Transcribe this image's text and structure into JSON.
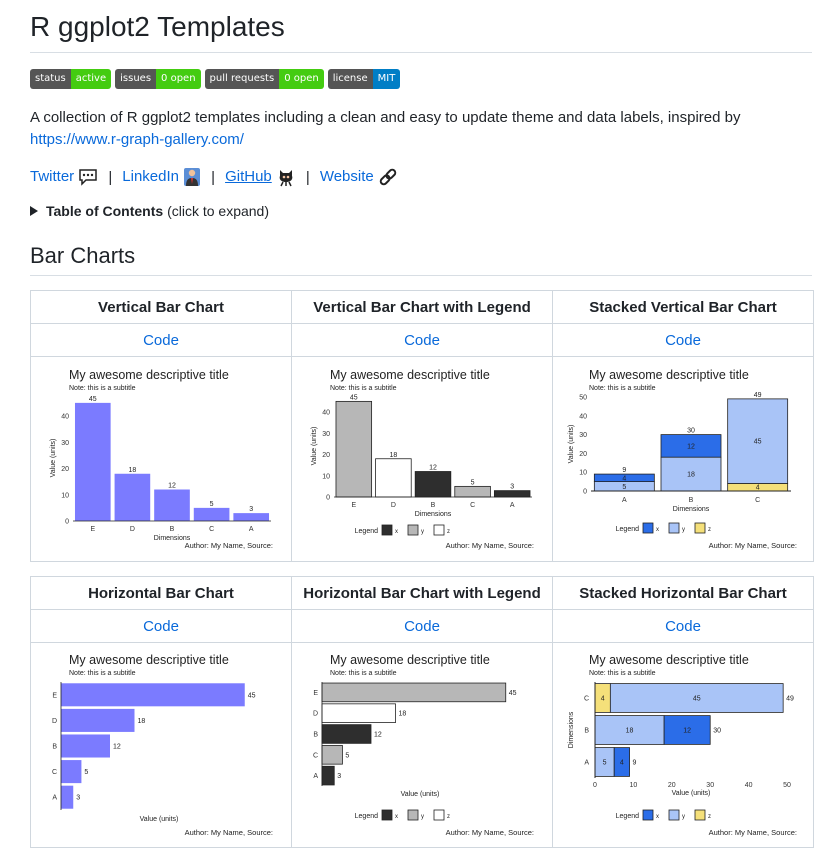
{
  "title": "R ggplot2 Templates",
  "badges": [
    {
      "label": "status",
      "value": "active",
      "color": "#4c1"
    },
    {
      "label": "issues",
      "value": "0 open",
      "color": "#4c1"
    },
    {
      "label": "pull requests",
      "value": "0 open",
      "color": "#4c1"
    },
    {
      "label": "license",
      "value": "MIT",
      "color": "#007ec6"
    }
  ],
  "description": "A collection of R ggplot2 templates including a clean and easy to update theme and data labels, inspired by",
  "description_link": "https://www.r-graph-gallery.com/",
  "social": {
    "twitter": "Twitter",
    "linkedin": "LinkedIn",
    "github": "GitHub",
    "website": "Website",
    "sep": "|"
  },
  "toc": {
    "label": "Table of Contents",
    "hint": "(click to expand)"
  },
  "section_title": "Bar Charts",
  "code_label": "Code",
  "headers_row1": [
    "Vertical Bar Chart",
    "Vertical Bar Chart with Legend",
    "Stacked Vertical Bar Chart"
  ],
  "headers_row2": [
    "Horizontal Bar Chart",
    "Horizontal Bar Chart with Legend",
    "Stacked Horizontal Bar Chart"
  ],
  "chart_common": {
    "title": "My awesome descriptive title",
    "subtitle": "Note: this is a subtitle",
    "caption": "Author: My Name, Source:",
    "legend_title": "Legend"
  },
  "colors": {
    "blue": "#7b7bff",
    "x": "#2e2e2e",
    "y": "#b7b7b7",
    "z": "#ffffff",
    "sx": "#2b6de8",
    "sy": "#a9c4f7",
    "sz": "#f5e07a"
  },
  "chart_data": [
    {
      "type": "bar",
      "name": "vbar",
      "categories": [
        "E",
        "D",
        "B",
        "C",
        "A"
      ],
      "values": [
        45,
        18,
        12,
        5,
        3
      ],
      "title": "My awesome descriptive title",
      "subtitle": "Note: this is a subtitle",
      "xlabel": "Dimensions",
      "ylabel": "Value (units)",
      "yticks": [
        0,
        10,
        20,
        30,
        40
      ],
      "ylim": [
        0,
        48
      ]
    },
    {
      "type": "bar",
      "name": "vbar-legend",
      "categories": [
        "E",
        "D",
        "B",
        "C",
        "A"
      ],
      "values": [
        45,
        18,
        12,
        5,
        3
      ],
      "groups": [
        "Y",
        "Z",
        "X",
        "Y",
        "X"
      ],
      "legend": [
        "X",
        "Y",
        "Z"
      ],
      "title": "My awesome descriptive title",
      "subtitle": "Note: this is a subtitle",
      "xlabel": "Dimensions",
      "ylabel": "Value (units)",
      "yticks": [
        0,
        10,
        20,
        30,
        40
      ],
      "ylim": [
        0,
        48
      ]
    },
    {
      "type": "bar",
      "name": "stacked-vbar",
      "categories": [
        "A",
        "B",
        "C"
      ],
      "series": [
        {
          "name": "X",
          "values": [
            4,
            12,
            0
          ]
        },
        {
          "name": "Y",
          "values": [
            5,
            18,
            45
          ]
        },
        {
          "name": "Z",
          "values": [
            0,
            0,
            4
          ]
        }
      ],
      "totals": [
        9,
        30,
        49
      ],
      "title": "My awesome descriptive title",
      "subtitle": "Note: this is a subtitle",
      "xlabel": "Dimensions",
      "ylabel": "Value (units)",
      "yticks": [
        0,
        10,
        20,
        30,
        40,
        50
      ],
      "ylim": [
        0,
        50
      ]
    },
    {
      "type": "bar",
      "name": "hbar",
      "categories": [
        "E",
        "D",
        "B",
        "C",
        "A"
      ],
      "values": [
        45,
        18,
        12,
        5,
        3
      ],
      "title": "My awesome descriptive title",
      "subtitle": "Note: this is a subtitle",
      "xlabel": "Value (units)",
      "xlim": [
        0,
        48
      ]
    },
    {
      "type": "bar",
      "name": "hbar-legend",
      "categories": [
        "E",
        "D",
        "B",
        "C",
        "A"
      ],
      "values": [
        45,
        18,
        12,
        5,
        3
      ],
      "groups": [
        "Y",
        "Z",
        "X",
        "Y",
        "X"
      ],
      "legend": [
        "X",
        "Y",
        "Z"
      ],
      "title": "My awesome descriptive title",
      "subtitle": "Note: this is a subtitle",
      "xlabel": "Value (units)",
      "xlim": [
        0,
        48
      ]
    },
    {
      "type": "bar",
      "name": "stacked-hbar",
      "categories": [
        "C",
        "B",
        "A"
      ],
      "series": [
        {
          "name": "X",
          "values": [
            0,
            12,
            4
          ]
        },
        {
          "name": "Y",
          "values": [
            45,
            18,
            5
          ]
        },
        {
          "name": "Z",
          "values": [
            4,
            0,
            0
          ]
        }
      ],
      "totals": [
        49,
        30,
        9
      ],
      "title": "My awesome descriptive title",
      "subtitle": "Note: this is a subtitle",
      "xlabel": "Value (units)",
      "ylabel": "Dimensions",
      "xticks": [
        0,
        10,
        20,
        30,
        40,
        50
      ],
      "xlim": [
        0,
        50
      ]
    }
  ]
}
